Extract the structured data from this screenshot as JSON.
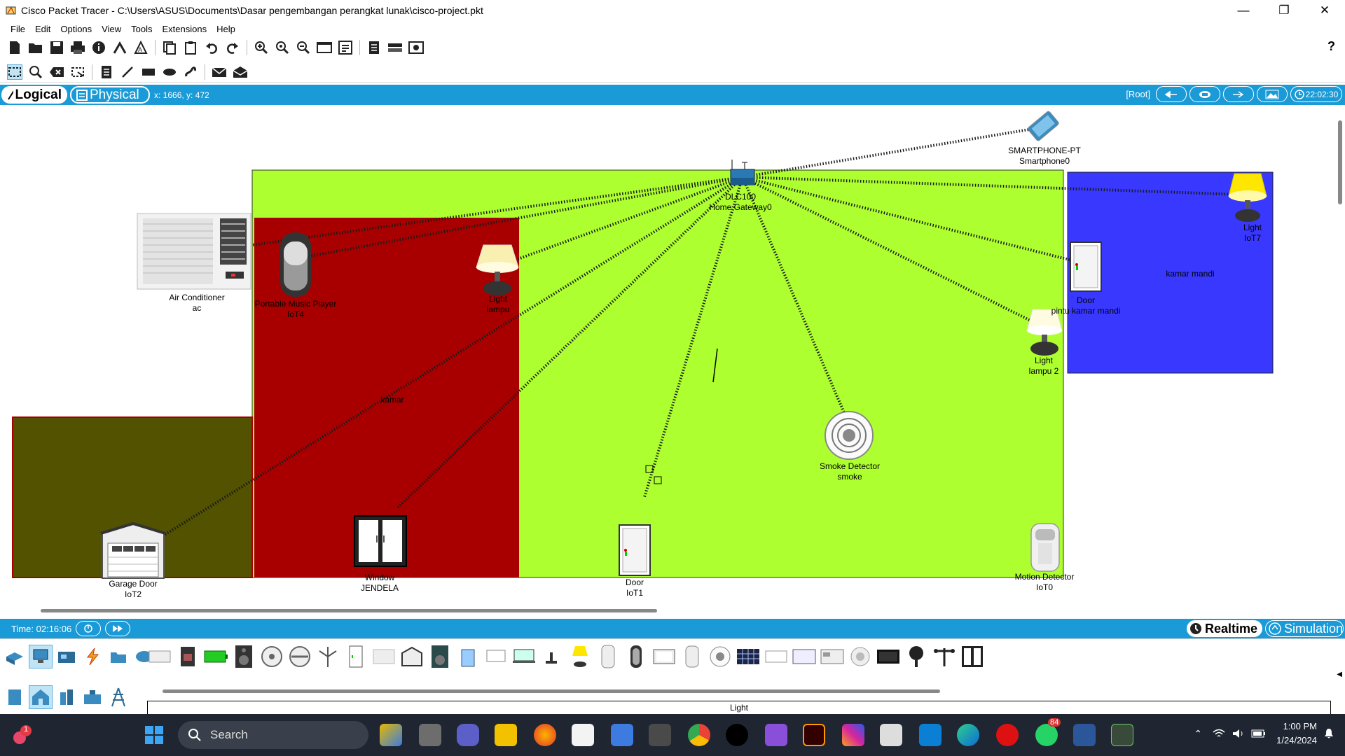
{
  "window": {
    "title": "Cisco Packet Tracer - C:\\Users\\ASUS\\Documents\\Dasar pengembangan perangkat lunak\\cisco-project.pkt",
    "minimize": "—",
    "maximize": "❐",
    "close": "✕"
  },
  "menu": [
    "File",
    "Edit",
    "Options",
    "View",
    "Tools",
    "Extensions",
    "Help"
  ],
  "mode_bar": {
    "logical": "Logical",
    "physical": "Physical",
    "coords": "x: 1666, y: 472",
    "root": "[Root]",
    "clock": "22:02:30"
  },
  "workspace": {
    "rooms": [
      "kamar",
      "kamar mandi"
    ],
    "devices": [
      {
        "type": "Air Conditioner",
        "name": "ac"
      },
      {
        "type": "Portable Music Player",
        "name": "IoT4"
      },
      {
        "type": "Light",
        "name": "lampu"
      },
      {
        "type": "DLC100",
        "name": "Home Gateway0"
      },
      {
        "type": "SMARTPHONE-PT",
        "name": "Smartphone0"
      },
      {
        "type": "Light",
        "name": "IoT7"
      },
      {
        "type": "Door",
        "name": "pintu kamar mandi"
      },
      {
        "type": "Light",
        "name": "lampu 2"
      },
      {
        "type": "Smoke Detector",
        "name": "smoke"
      },
      {
        "type": "Garage Door",
        "name": "IoT2"
      },
      {
        "type": "Window",
        "name": "JENDELA"
      },
      {
        "type": "Door",
        "name": "IoT1"
      },
      {
        "type": "Motion Detector",
        "name": "IoT0"
      }
    ],
    "colors": {
      "main_room": "#adff2f",
      "kamar": "#a80000",
      "kamar_mandi": "#3838ff",
      "garage": "#525200",
      "mode_bar": "#1a9bd7"
    }
  },
  "time_bar": {
    "time": "Time: 02:16:06",
    "realtime": "Realtime",
    "simulation": "Simulation"
  },
  "palette": {
    "selected_device": "Light"
  },
  "taskbar": {
    "search": "Search",
    "notification_badge": "1",
    "whatsapp_badge": "84",
    "time": "1:00 PM",
    "date": "1/24/2024"
  }
}
